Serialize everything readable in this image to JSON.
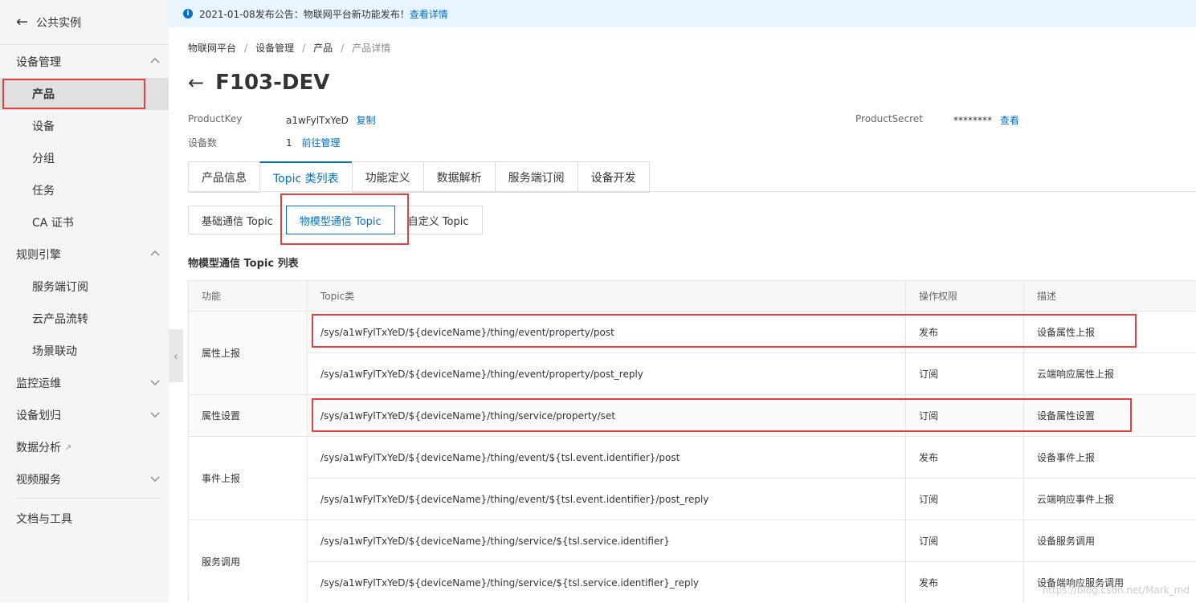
{
  "sidebar": {
    "back_label": "公共实例",
    "groups": [
      {
        "label": "设备管理",
        "expanded": true,
        "items": [
          "产品",
          "设备",
          "分组",
          "任务",
          "CA 证书"
        ]
      },
      {
        "label": "规则引擎",
        "expanded": true,
        "items": [
          "服务端订阅",
          "云产品流转",
          "场景联动"
        ]
      },
      {
        "label": "监控运维",
        "expanded": false
      },
      {
        "label": "设备划归",
        "expanded": false
      },
      {
        "label": "数据分析",
        "expanded": false
      },
      {
        "label": "视频服务",
        "expanded": false
      }
    ],
    "active_item": "产品",
    "docs_label": "文档与工具"
  },
  "notice": {
    "text": "2021-01-08发布公告：物联网平台新功能发布！",
    "link": "查看详情"
  },
  "breadcrumb": [
    "物联网平台",
    "设备管理",
    "产品",
    "产品详情"
  ],
  "product": {
    "title": "F103-DEV",
    "product_key_label": "ProductKey",
    "product_key": "a1wFylTxYeD",
    "copy_label": "复制",
    "device_count_label": "设备数",
    "device_count": "1",
    "manage_label": "前往管理",
    "secret_label": "ProductSecret",
    "secret": "********",
    "view_label": "查看"
  },
  "tabs": [
    "产品信息",
    "Topic 类列表",
    "功能定义",
    "数据解析",
    "服务端订阅",
    "设备开发"
  ],
  "active_tab": "Topic 类列表",
  "subtabs": [
    "基础通信 Topic",
    "物模型通信 Topic",
    "自定义 Topic"
  ],
  "active_subtab": "物模型通信 Topic",
  "section_title": "物模型通信 Topic 列表",
  "table": {
    "headers": [
      "功能",
      "Topic类",
      "操作权限",
      "描述"
    ],
    "groups": [
      {
        "function": "属性上报",
        "rows": [
          {
            "topic": "/sys/a1wFylTxYeD/${deviceName}/thing/event/property/post",
            "perm": "发布",
            "desc": "设备属性上报"
          },
          {
            "topic": "/sys/a1wFylTxYeD/${deviceName}/thing/event/property/post_reply",
            "perm": "订阅",
            "desc": "云端响应属性上报"
          }
        ]
      },
      {
        "function": "属性设置",
        "rows": [
          {
            "topic": "/sys/a1wFylTxYeD/${deviceName}/thing/service/property/set",
            "perm": "订阅",
            "desc": "设备属性设置"
          }
        ]
      },
      {
        "function": "事件上报",
        "rows": [
          {
            "topic": "/sys/a1wFylTxYeD/${deviceName}/thing/event/${tsl.event.identifier}/post",
            "perm": "发布",
            "desc": "设备事件上报"
          },
          {
            "topic": "/sys/a1wFylTxYeD/${deviceName}/thing/event/${tsl.event.identifier}/post_reply",
            "perm": "订阅",
            "desc": "云端响应事件上报"
          }
        ]
      },
      {
        "function": "服务调用",
        "rows": [
          {
            "topic": "/sys/a1wFylTxYeD/${deviceName}/thing/service/${tsl.service.identifier}",
            "perm": "订阅",
            "desc": "设备服务调用"
          },
          {
            "topic": "/sys/a1wFylTxYeD/${deviceName}/thing/service/${tsl.service.identifier}_reply",
            "perm": "发布",
            "desc": "设备端响应服务调用"
          }
        ]
      }
    ]
  },
  "watermark": "https://blog.csdn.net/Mark_md",
  "colors": {
    "accent": "#0070cc",
    "highlight": "#e34141",
    "notice_bg": "#e8f4ff"
  }
}
